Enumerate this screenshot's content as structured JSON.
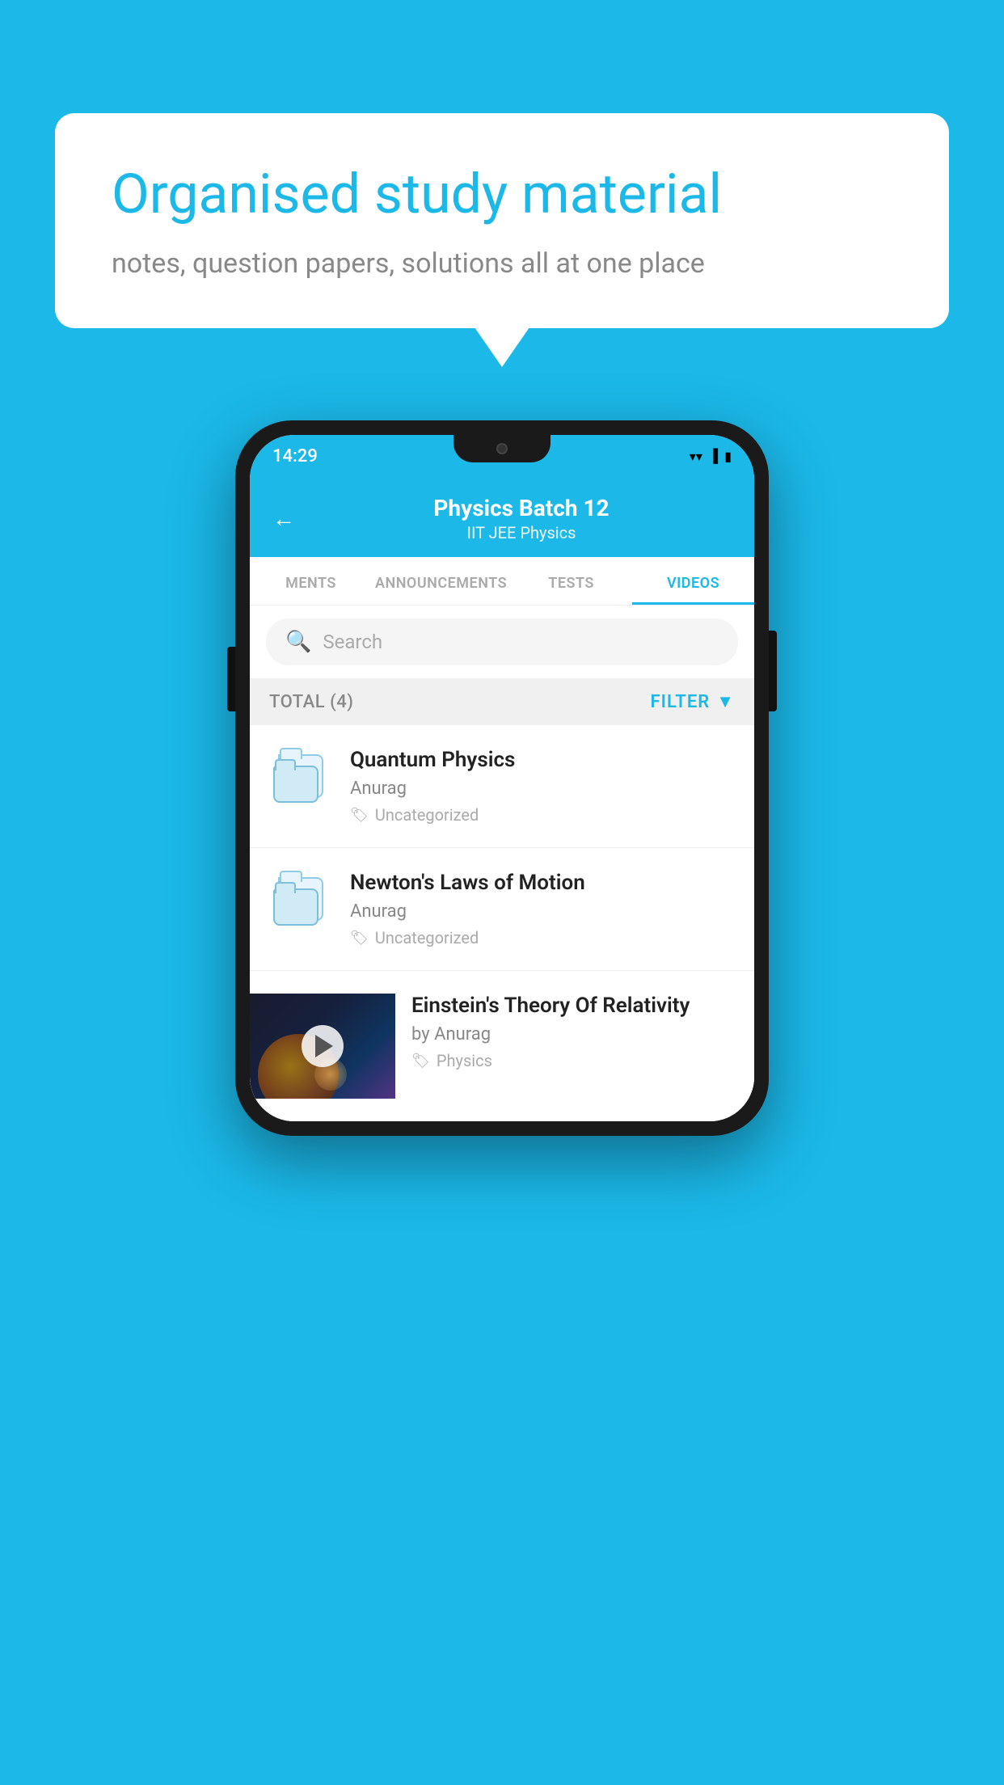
{
  "page": {
    "background_color": "#1bb8e8"
  },
  "speech_bubble": {
    "title": "Organised study material",
    "subtitle": "notes, question papers, solutions all at one place"
  },
  "phone": {
    "status_bar": {
      "time": "14:29",
      "icons": [
        "wifi",
        "signal",
        "battery"
      ]
    },
    "header": {
      "back_label": "←",
      "title": "Physics Batch 12",
      "subtitle": "IIT JEE   Physics"
    },
    "tabs": [
      {
        "label": "MENTS",
        "active": false
      },
      {
        "label": "ANNOUNCEMENTS",
        "active": false
      },
      {
        "label": "TESTS",
        "active": false
      },
      {
        "label": "VIDEOS",
        "active": true
      }
    ],
    "search": {
      "placeholder": "Search"
    },
    "filter_bar": {
      "total_label": "TOTAL (4)",
      "filter_label": "FILTER"
    },
    "videos": [
      {
        "title": "Quantum Physics",
        "author": "Anurag",
        "tag": "Uncategorized",
        "type": "folder"
      },
      {
        "title": "Newton's Laws of Motion",
        "author": "Anurag",
        "tag": "Uncategorized",
        "type": "folder"
      },
      {
        "title": "Einstein's Theory Of Relativity",
        "author": "by Anurag",
        "tag": "Physics",
        "type": "video"
      }
    ]
  }
}
